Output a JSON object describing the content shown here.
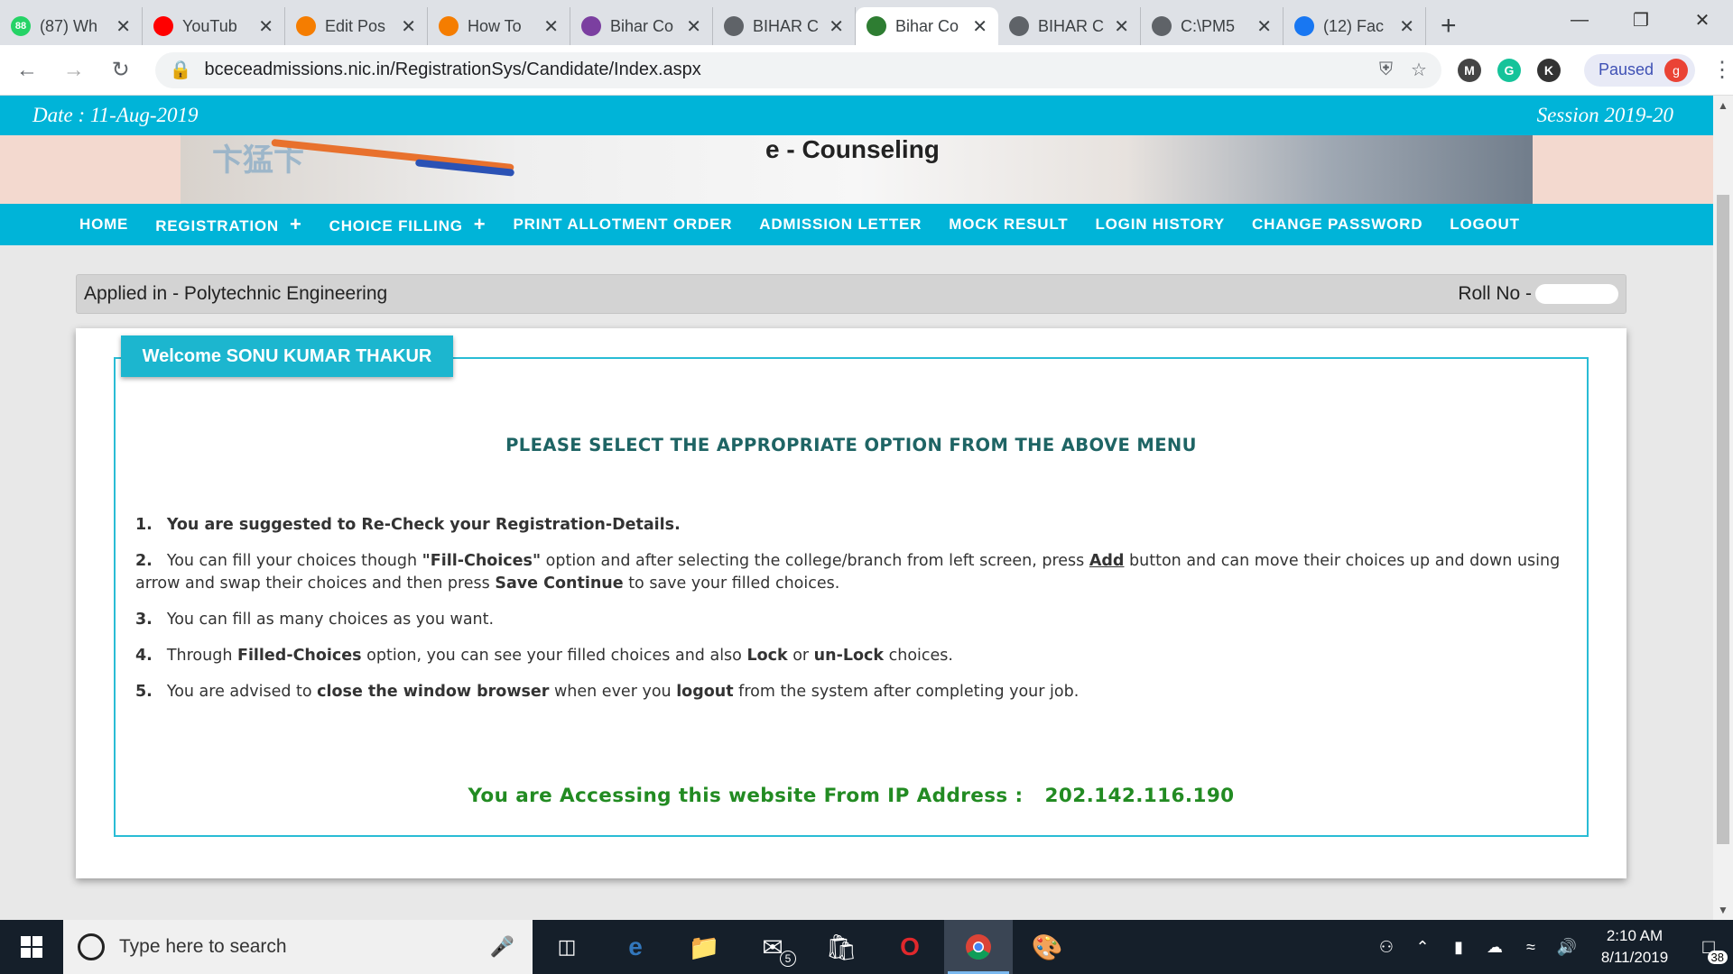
{
  "browser": {
    "tabs": [
      {
        "title": "(87) Wh",
        "favicon": "whatsapp-icon",
        "color": "#25d366",
        "badge": "88"
      },
      {
        "title": "YouTub",
        "favicon": "youtube-icon",
        "color": "#ff0000"
      },
      {
        "title": "Edit Pos",
        "favicon": "blogger-icon",
        "color": "#f57d00"
      },
      {
        "title": "How To",
        "favicon": "blogger-icon",
        "color": "#f57d00"
      },
      {
        "title": "Bihar Co",
        "favicon": "site-icon",
        "color": "#7b3fa0"
      },
      {
        "title": "BIHAR C",
        "favicon": "globe-icon",
        "color": "#5f6368"
      },
      {
        "title": "Bihar Co",
        "favicon": "emblem-icon",
        "color": "#2e7d32",
        "active": true
      },
      {
        "title": "BIHAR C",
        "favicon": "globe-icon",
        "color": "#5f6368"
      },
      {
        "title": "C:\\PM5",
        "favicon": "globe-icon",
        "color": "#5f6368"
      },
      {
        "title": "(12) Fac",
        "favicon": "facebook-icon",
        "color": "#1877f2"
      }
    ],
    "new_tab": "+",
    "url": "bceceadmissions.nic.in/RegistrationSys/Candidate/Index.aspx",
    "paused_label": "Paused",
    "profile_initial": "g",
    "extensions": [
      {
        "name": "m-extension-icon",
        "letter": "M",
        "color": "#444"
      },
      {
        "name": "grammarly-icon",
        "letter": "G",
        "color": "#15c39a"
      },
      {
        "name": "k-extension-icon",
        "letter": "K",
        "color": "#333"
      }
    ]
  },
  "site": {
    "date": "Date : 11-Aug-2019",
    "session": "Session 2019-20",
    "banner_title": "e - Counseling",
    "nav": [
      {
        "label": "HOME",
        "plus": false
      },
      {
        "label": "REGISTRATION",
        "plus": true
      },
      {
        "label": "CHOICE FILLING",
        "plus": true
      },
      {
        "label": "PRINT ALLOTMENT ORDER",
        "plus": false
      },
      {
        "label": "ADMISSION LETTER",
        "plus": false
      },
      {
        "label": "MOCK RESULT",
        "plus": false
      },
      {
        "label": "LOGIN HISTORY",
        "plus": false
      },
      {
        "label": "CHANGE PASSWORD",
        "plus": false
      },
      {
        "label": "LOGOUT",
        "plus": false
      }
    ],
    "applied": "Applied in - Polytechnic Engineering",
    "roll_label": "Roll No -",
    "welcome": "Welcome SONU KUMAR THAKUR",
    "select_message": "PLEASE SELECT THE APPROPRIATE OPTION FROM THE ABOVE MENU",
    "instructions": {
      "i1": {
        "num": "1.",
        "text": "You are suggested to Re-Check your Registration-Details."
      },
      "i2": {
        "num": "2.",
        "a": "You can fill your choices though ",
        "b": "\"Fill-Choices\"",
        "c": " option and after selecting the college/branch from left screen, press ",
        "d": "Add",
        "e": " button and can move their choices up and down using arrow and swap their choices and then press ",
        "f": "Save Continue",
        "g": " to save your filled choices."
      },
      "i3": {
        "num": "3.",
        "text": "You can fill as many choices as you want."
      },
      "i4": {
        "num": "4.",
        "a": "Through ",
        "b": "Filled-Choices",
        "c": " option, you can see your filled choices and also ",
        "d": "Lock",
        "e": " or ",
        "f": "un-Lock",
        "g": " choices."
      },
      "i5": {
        "num": "5.",
        "a": "You are advised to ",
        "b": "close the window browser",
        "c": " when ever you ",
        "d": "logout",
        "e": " from the system after completing your job."
      }
    },
    "ip_label": "You are Accessing this website From IP Address :",
    "ip_value": "202.142.116.190"
  },
  "taskbar": {
    "search_placeholder": "Type here to search",
    "mail_badge": "5",
    "time": "2:10 AM",
    "date": "8/11/2019",
    "notifications": "38"
  }
}
